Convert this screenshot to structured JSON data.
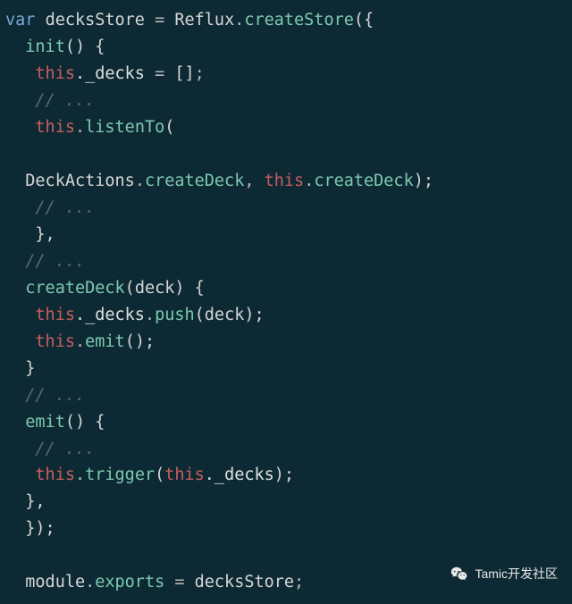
{
  "code": {
    "l1": {
      "var": "var",
      "id1": "decksStore",
      "eq": " = ",
      "id2": "Reflux",
      "dot": ".",
      "fn": "createStore",
      "punc": "({"
    },
    "l2": {
      "fn": "init",
      "punc": "() {"
    },
    "l3": {
      "this": "this",
      "prop": "._decks",
      "eq": " = ",
      "arr": "[]",
      "semi": ";"
    },
    "l4": {
      "comment": "// ..."
    },
    "l5": {
      "this": "this",
      "dot": ".",
      "fn": "listenTo",
      "paren": "("
    },
    "l6": "",
    "l7": {
      "id": "DeckActions",
      "dot": ".",
      "prop": "createDeck",
      "comma": ", ",
      "this": "this",
      "dot2": ".",
      "prop2": "createDeck",
      "close": ");"
    },
    "l8": {
      "comment": "// ..."
    },
    "l9": {
      "brace": "},"
    },
    "l10": {
      "comment": "// ..."
    },
    "l11": {
      "fn": "createDeck",
      "open": "(",
      "arg": "deck",
      "close": ") {"
    },
    "l12": {
      "this": "this",
      "prop": "._decks",
      "dot": ".",
      "fn": "push",
      "open": "(",
      "arg": "deck",
      "close": ");"
    },
    "l13": {
      "this": "this",
      "dot": ".",
      "fn": "emit",
      "call": "();"
    },
    "l14": {
      "brace": "}"
    },
    "l15": {
      "comment": "// ..."
    },
    "l16": {
      "fn": "emit",
      "punc": "() {"
    },
    "l17": {
      "comment": "// ..."
    },
    "l18": {
      "this": "this",
      "dot": ".",
      "fn": "trigger",
      "open": "(",
      "this2": "this",
      "prop": "._decks",
      "close": ");"
    },
    "l19": {
      "brace": "},"
    },
    "l20": {
      "brace": "});"
    },
    "l21": "",
    "l22": {
      "id": "module",
      "dot": ".",
      "prop": "exports",
      "eq": " = ",
      "id2": "decksStore",
      "semi": ";"
    }
  },
  "watermark": {
    "text": "Tamic开发社区"
  }
}
